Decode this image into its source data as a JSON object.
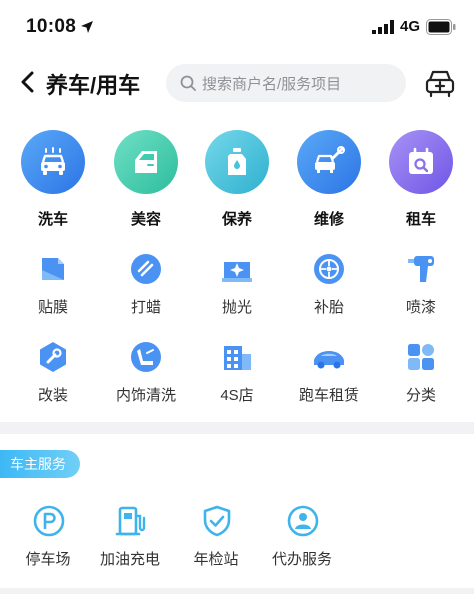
{
  "status_bar": {
    "time": "10:08",
    "network": "4G"
  },
  "header": {
    "title": "养车/用车",
    "search_placeholder": "搜索商户名/服务项目"
  },
  "main_categories": [
    {
      "label": "洗车",
      "icon": "car-wash-icon",
      "color": "#3d8ef2"
    },
    {
      "label": "美容",
      "icon": "car-door-icon",
      "color": "#3ecdb0"
    },
    {
      "label": "保养",
      "icon": "oil-can-icon",
      "color": "#4ac3da"
    },
    {
      "label": "维修",
      "icon": "car-repair-icon",
      "color": "#3d8ef2"
    },
    {
      "label": "租车",
      "icon": "calendar-car-icon",
      "color": "#8a70ee"
    }
  ],
  "sub_categories": [
    {
      "label": "贴膜",
      "icon": "film-icon"
    },
    {
      "label": "打蜡",
      "icon": "wax-icon"
    },
    {
      "label": "抛光",
      "icon": "polish-icon"
    },
    {
      "label": "补胎",
      "icon": "tire-icon"
    },
    {
      "label": "喷漆",
      "icon": "spray-gun-icon"
    },
    {
      "label": "改装",
      "icon": "wrench-hex-icon"
    },
    {
      "label": "内饰清洗",
      "icon": "car-seat-icon"
    },
    {
      "label": "4S店",
      "icon": "building-icon"
    },
    {
      "label": "跑车租赁",
      "icon": "sports-car-icon"
    },
    {
      "label": "分类",
      "icon": "grid-icon"
    }
  ],
  "owner_services": {
    "badge": "车主服务",
    "items": [
      {
        "label": "停车场",
        "icon": "parking-icon"
      },
      {
        "label": "加油充电",
        "icon": "fuel-pump-icon"
      },
      {
        "label": "年检站",
        "icon": "shield-check-icon"
      },
      {
        "label": "代办服务",
        "icon": "agent-icon"
      }
    ]
  },
  "colors": {
    "primary_blue": "#3d8ef2",
    "light_blue": "#7fb9f7",
    "badge_blue": "#3db8f5"
  }
}
